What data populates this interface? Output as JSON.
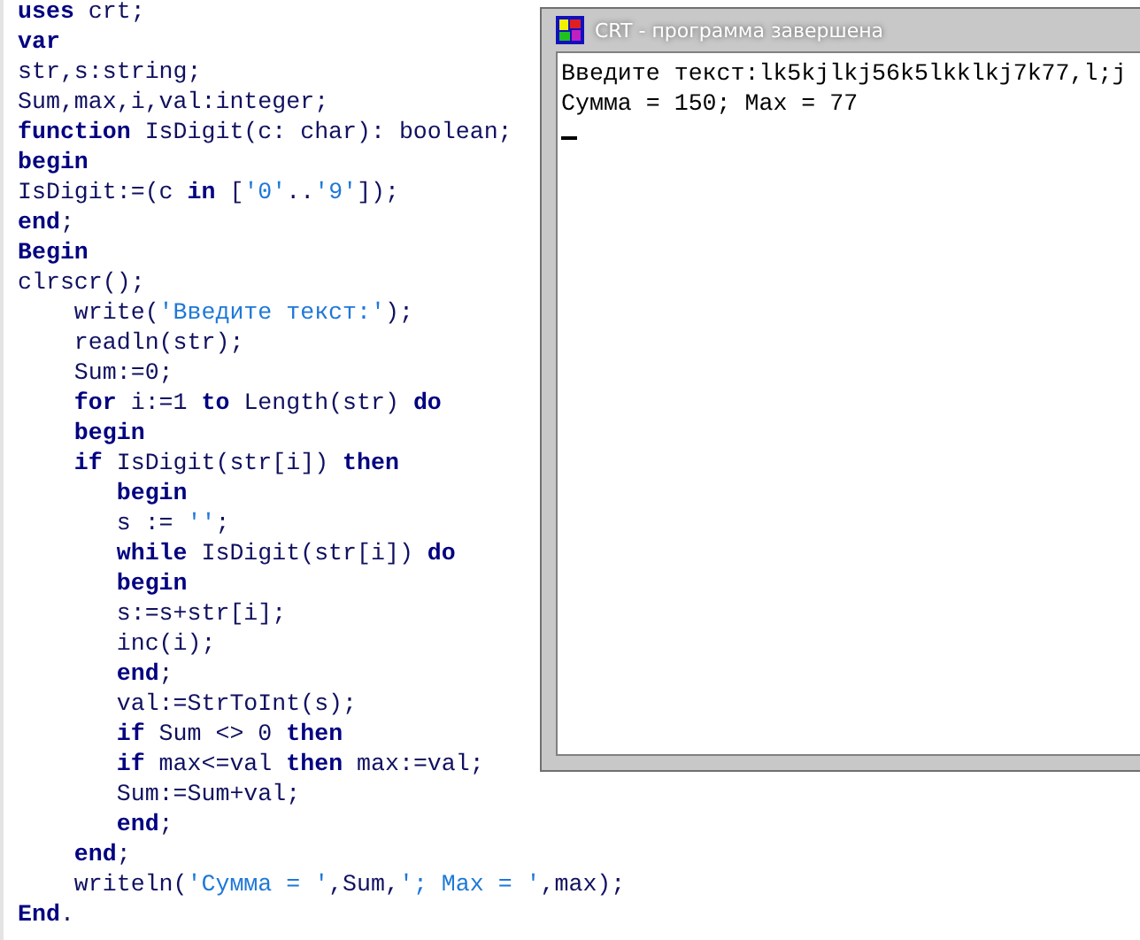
{
  "editor": {
    "lines": [
      {
        "tokens": [
          {
            "kind": "keyword",
            "text": "uses"
          },
          {
            "kind": "plain",
            "text": " crt;"
          }
        ]
      },
      {
        "tokens": [
          {
            "kind": "keyword",
            "text": "var"
          }
        ]
      },
      {
        "tokens": [
          {
            "kind": "plain",
            "text": "str,s:string;"
          }
        ]
      },
      {
        "tokens": [
          {
            "kind": "plain",
            "text": "Sum,max,i,val:integer;"
          }
        ]
      },
      {
        "tokens": [
          {
            "kind": "keyword",
            "text": "function"
          },
          {
            "kind": "plain",
            "text": " IsDigit(c: char): boolean;"
          }
        ]
      },
      {
        "tokens": [
          {
            "kind": "keyword",
            "text": "begin"
          }
        ]
      },
      {
        "tokens": [
          {
            "kind": "plain",
            "text": "IsDigit:=(c "
          },
          {
            "kind": "keyword",
            "text": "in"
          },
          {
            "kind": "plain",
            "text": " ["
          },
          {
            "kind": "string",
            "text": "'0'"
          },
          {
            "kind": "plain",
            "text": ".."
          },
          {
            "kind": "string",
            "text": "'9'"
          },
          {
            "kind": "plain",
            "text": "]);"
          }
        ]
      },
      {
        "tokens": [
          {
            "kind": "keyword",
            "text": "end"
          },
          {
            "kind": "plain",
            "text": ";"
          }
        ]
      },
      {
        "tokens": [
          {
            "kind": "keyword",
            "text": "Begin"
          }
        ]
      },
      {
        "tokens": [
          {
            "kind": "plain",
            "text": "clrscr();"
          }
        ]
      },
      {
        "tokens": [
          {
            "kind": "plain",
            "text": "    write("
          },
          {
            "kind": "string",
            "text": "'Введите текст:'"
          },
          {
            "kind": "plain",
            "text": ");"
          }
        ]
      },
      {
        "tokens": [
          {
            "kind": "plain",
            "text": "    readln(str);"
          }
        ]
      },
      {
        "tokens": [
          {
            "kind": "plain",
            "text": "    Sum:=0;"
          }
        ]
      },
      {
        "tokens": [
          {
            "kind": "keyword",
            "text": "    for"
          },
          {
            "kind": "plain",
            "text": " i:=1 "
          },
          {
            "kind": "keyword",
            "text": "to"
          },
          {
            "kind": "plain",
            "text": " Length(str) "
          },
          {
            "kind": "keyword",
            "text": "do"
          }
        ]
      },
      {
        "tokens": [
          {
            "kind": "keyword",
            "text": "    begin"
          }
        ]
      },
      {
        "tokens": [
          {
            "kind": "keyword",
            "text": "    if"
          },
          {
            "kind": "plain",
            "text": " IsDigit(str[i]) "
          },
          {
            "kind": "keyword",
            "text": "then"
          }
        ]
      },
      {
        "tokens": [
          {
            "kind": "keyword",
            "text": "       begin"
          }
        ]
      },
      {
        "tokens": [
          {
            "kind": "plain",
            "text": "       s := "
          },
          {
            "kind": "string",
            "text": "''"
          },
          {
            "kind": "plain",
            "text": ";"
          }
        ]
      },
      {
        "tokens": [
          {
            "kind": "keyword",
            "text": "       while"
          },
          {
            "kind": "plain",
            "text": " IsDigit(str[i]) "
          },
          {
            "kind": "keyword",
            "text": "do"
          }
        ]
      },
      {
        "tokens": [
          {
            "kind": "keyword",
            "text": "       begin"
          }
        ]
      },
      {
        "tokens": [
          {
            "kind": "plain",
            "text": "       s:=s+str[i];"
          }
        ]
      },
      {
        "tokens": [
          {
            "kind": "plain",
            "text": "       inc(i);"
          }
        ]
      },
      {
        "tokens": [
          {
            "kind": "keyword",
            "text": "       end"
          },
          {
            "kind": "plain",
            "text": ";"
          }
        ]
      },
      {
        "tokens": [
          {
            "kind": "plain",
            "text": "       val:=StrToInt(s);"
          }
        ]
      },
      {
        "tokens": [
          {
            "kind": "keyword",
            "text": "       if"
          },
          {
            "kind": "plain",
            "text": " Sum <> 0 "
          },
          {
            "kind": "keyword",
            "text": "then"
          }
        ]
      },
      {
        "tokens": [
          {
            "kind": "keyword",
            "text": "       if"
          },
          {
            "kind": "plain",
            "text": " max<=val "
          },
          {
            "kind": "keyword",
            "text": "then"
          },
          {
            "kind": "plain",
            "text": " max:=val;"
          }
        ]
      },
      {
        "tokens": [
          {
            "kind": "plain",
            "text": "       Sum:=Sum+val;"
          }
        ]
      },
      {
        "tokens": [
          {
            "kind": "keyword",
            "text": "       end"
          },
          {
            "kind": "plain",
            "text": ";"
          }
        ]
      },
      {
        "tokens": [
          {
            "kind": "keyword",
            "text": "    end"
          },
          {
            "kind": "plain",
            "text": ";"
          }
        ]
      },
      {
        "tokens": [
          {
            "kind": "plain",
            "text": "    writeln("
          },
          {
            "kind": "string",
            "text": "'Сумма = '"
          },
          {
            "kind": "plain",
            "text": ",Sum,"
          },
          {
            "kind": "string",
            "text": "'; Max = '"
          },
          {
            "kind": "plain",
            "text": ",max);"
          }
        ]
      },
      {
        "tokens": [
          {
            "kind": "keyword",
            "text": "End"
          },
          {
            "kind": "plain",
            "text": "."
          }
        ]
      }
    ]
  },
  "crt_window": {
    "title": "CRT - программа завершена",
    "output": [
      "Введите текст:lk5kjlkj56k5lkklkj7k77,l;j",
      "Сумма = 150; Max = 77"
    ],
    "cursor": true
  }
}
